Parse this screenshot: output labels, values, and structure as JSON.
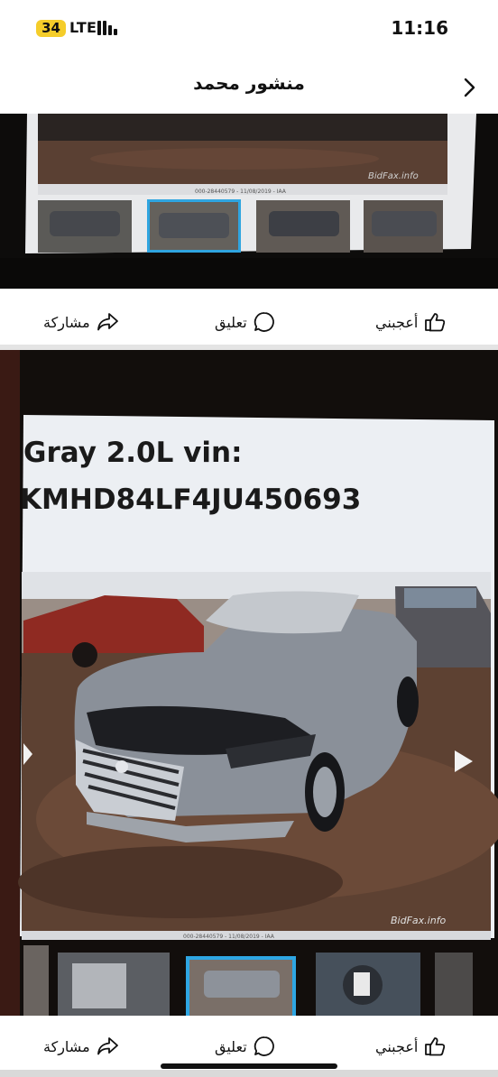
{
  "status_bar": {
    "battery": "34",
    "carrier": "LTE",
    "time": "11:16"
  },
  "header": {
    "title": "منشور محمد",
    "back_icon": "chevron-right-icon"
  },
  "post1": {
    "watermark": "BidFax.info",
    "caption": "000-28440579 - 11/08/2019 - IAA"
  },
  "post2": {
    "line1": "Gray 2.0L vin:",
    "line2": "KMHD84LF4JU450693",
    "watermark": "BidFax.info",
    "caption": "000-28440579 - 11/08/2019 - IAA"
  },
  "actions": {
    "like_label": "أعجبني",
    "comment_label": "تعليق",
    "share_label": "مشاركة",
    "like_icon": "thumbs-up-icon",
    "comment_icon": "comment-bubble-icon",
    "share_icon": "share-arrow-icon"
  }
}
